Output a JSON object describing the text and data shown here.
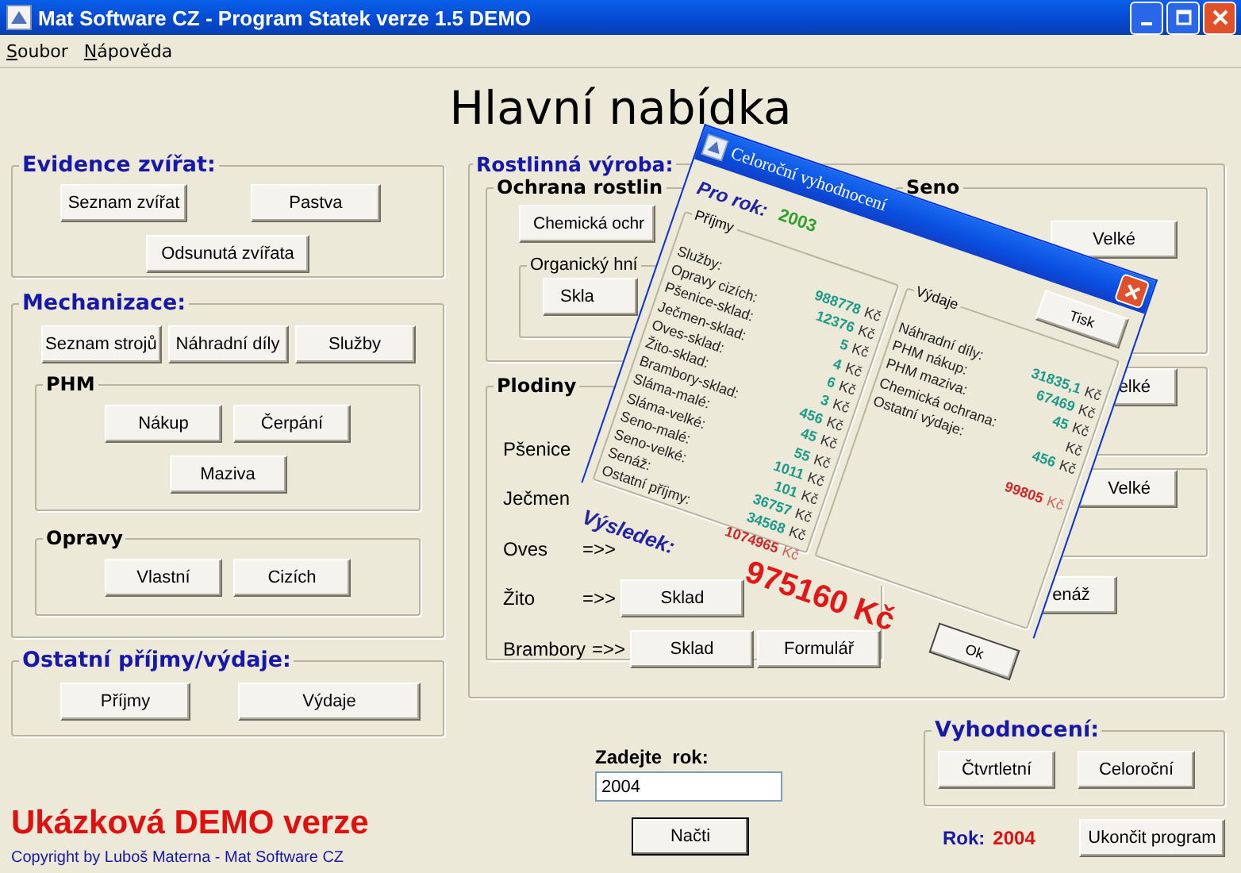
{
  "window": {
    "title": "Mat Software CZ - Program Statek verze 1.5 DEMO"
  },
  "menu": [
    "Soubor",
    "Nápověda"
  ],
  "heading": "Hlavní nabídka",
  "evidence_zvirat": {
    "title": "Evidence zvířat:",
    "buttons": [
      "Seznam zvířat",
      "Pastva",
      "Odsunutá zvířata"
    ]
  },
  "mechanizace": {
    "title": "Mechanizace:",
    "buttons": [
      "Seznam strojů",
      "Náhradní díly",
      "Služby"
    ],
    "phm": {
      "title": "PHM",
      "buttons": [
        "Nákup",
        "Čerpání",
        "Maziva"
      ]
    },
    "opravy": {
      "title": "Opravy",
      "buttons": [
        "Vlastní",
        "Cizích"
      ]
    }
  },
  "ostatni": {
    "title": "Ostatní příjmy/výdaje:",
    "buttons": [
      "Příjmy",
      "Výdaje"
    ]
  },
  "rostlinna_vyroba": {
    "title": "Rostlinná výroba:",
    "ochrana_rostlin": {
      "title": "Ochrana rostlin",
      "button": "Chemická ochr",
      "organicky": {
        "title": "Organický hní",
        "button": "Skla"
      }
    },
    "plodiny": {
      "title": "Plodiny",
      "rows": [
        {
          "label": "Pšenice"
        },
        {
          "label": "Ječmen"
        },
        {
          "label": "Oves",
          "arrow": "=>>"
        },
        {
          "label": "Žito",
          "arrow": "=>>",
          "buttons": [
            "Sklad"
          ]
        },
        {
          "label": "Brambory",
          "arrow": "=>>",
          "buttons": [
            "Sklad",
            "Formulář"
          ]
        }
      ]
    },
    "seno": {
      "title": "Seno",
      "button": "Velké"
    },
    "right_buttons": [
      "elké",
      "Velké"
    ],
    "bottom_button": "enáž"
  },
  "year_input": {
    "label": "Zadejte  rok:",
    "value": "2004"
  },
  "load_button": "Načti",
  "demo_text": "Ukázková DEMO verze",
  "copyright": "Copyright by Luboš Materna - Mat Software CZ",
  "vyhodnoceni": {
    "title": "Vyhodnocení:",
    "buttons": [
      "Čtvrtletní",
      "Celoroční"
    ]
  },
  "rok": {
    "label": "Rok:",
    "value": "2004"
  },
  "exit_button": "Ukončit program",
  "dialog": {
    "title": "Celoroční vyhodnocení",
    "year_label": "Pro rok:",
    "year": "2003",
    "print_button": "Tisk",
    "income": {
      "title": "Příjmy",
      "labels": [
        "Služby:",
        "Opravy cizích:",
        "Pšenice-sklad:",
        "Ječmen-sklad:",
        "Oves-sklad:",
        "Žito-sklad:",
        "Brambory-sklad:",
        "Sláma-malé:",
        "Sláma-velké:",
        "Seno-malé:",
        "Seno-velké:",
        "Senáž:",
        "Ostatní příjmy:"
      ],
      "values": [
        {
          "value": "988778",
          "currency": "Kč"
        },
        {
          "value": "12376",
          "currency": "Kč"
        },
        {
          "value": "5",
          "currency": "Kč"
        },
        {
          "value": "4",
          "currency": "Kč"
        },
        {
          "value": "6",
          "currency": "Kč"
        },
        {
          "value": "3",
          "currency": "Kč"
        },
        {
          "value": "456",
          "currency": "Kč"
        },
        {
          "value": "45",
          "currency": "Kč"
        },
        {
          "value": "55",
          "currency": "Kč"
        },
        {
          "value": "1011",
          "currency": "Kč"
        },
        {
          "value": "101",
          "currency": "Kč"
        },
        {
          "value": "36757",
          "currency": "Kč"
        },
        {
          "value": "34568",
          "currency": "Kč"
        }
      ],
      "total": "1074965",
      "total_currency": "Kč"
    },
    "expenses": {
      "title": "Výdaje",
      "labels": [
        "Náhradní díly:",
        "PHM nákup:",
        "PHM maziva:",
        "Chemická ochrana:",
        "Ostatní výdaje:"
      ],
      "values": [
        {
          "value": "31835,1",
          "currency": "Kč"
        },
        {
          "value": "67469",
          "currency": "Kč"
        },
        {
          "value": "45",
          "currency": "Kč"
        },
        {
          "currency": "Kč"
        },
        {
          "value": "456",
          "currency": "Kč"
        }
      ],
      "total": "99805",
      "total_currency": "Kč"
    },
    "result_label": "Výsledek:",
    "result": "975160 Kč",
    "ok_button": "Ok"
  }
}
